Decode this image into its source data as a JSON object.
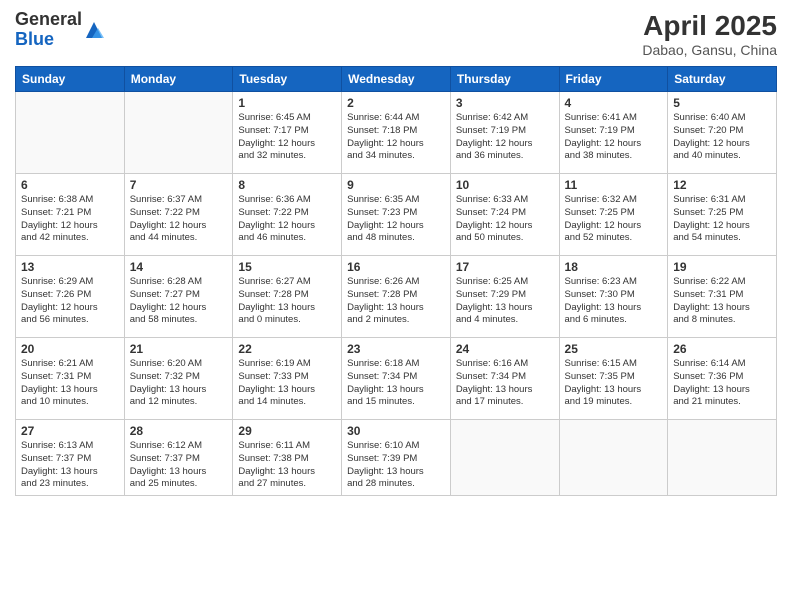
{
  "header": {
    "logo_general": "General",
    "logo_blue": "Blue",
    "month_year": "April 2025",
    "location": "Dabao, Gansu, China"
  },
  "weekdays": [
    "Sunday",
    "Monday",
    "Tuesday",
    "Wednesday",
    "Thursday",
    "Friday",
    "Saturday"
  ],
  "days": [
    {
      "num": "",
      "info": ""
    },
    {
      "num": "",
      "info": ""
    },
    {
      "num": "1",
      "info": "Sunrise: 6:45 AM\nSunset: 7:17 PM\nDaylight: 12 hours\nand 32 minutes."
    },
    {
      "num": "2",
      "info": "Sunrise: 6:44 AM\nSunset: 7:18 PM\nDaylight: 12 hours\nand 34 minutes."
    },
    {
      "num": "3",
      "info": "Sunrise: 6:42 AM\nSunset: 7:19 PM\nDaylight: 12 hours\nand 36 minutes."
    },
    {
      "num": "4",
      "info": "Sunrise: 6:41 AM\nSunset: 7:19 PM\nDaylight: 12 hours\nand 38 minutes."
    },
    {
      "num": "5",
      "info": "Sunrise: 6:40 AM\nSunset: 7:20 PM\nDaylight: 12 hours\nand 40 minutes."
    },
    {
      "num": "6",
      "info": "Sunrise: 6:38 AM\nSunset: 7:21 PM\nDaylight: 12 hours\nand 42 minutes."
    },
    {
      "num": "7",
      "info": "Sunrise: 6:37 AM\nSunset: 7:22 PM\nDaylight: 12 hours\nand 44 minutes."
    },
    {
      "num": "8",
      "info": "Sunrise: 6:36 AM\nSunset: 7:22 PM\nDaylight: 12 hours\nand 46 minutes."
    },
    {
      "num": "9",
      "info": "Sunrise: 6:35 AM\nSunset: 7:23 PM\nDaylight: 12 hours\nand 48 minutes."
    },
    {
      "num": "10",
      "info": "Sunrise: 6:33 AM\nSunset: 7:24 PM\nDaylight: 12 hours\nand 50 minutes."
    },
    {
      "num": "11",
      "info": "Sunrise: 6:32 AM\nSunset: 7:25 PM\nDaylight: 12 hours\nand 52 minutes."
    },
    {
      "num": "12",
      "info": "Sunrise: 6:31 AM\nSunset: 7:25 PM\nDaylight: 12 hours\nand 54 minutes."
    },
    {
      "num": "13",
      "info": "Sunrise: 6:29 AM\nSunset: 7:26 PM\nDaylight: 12 hours\nand 56 minutes."
    },
    {
      "num": "14",
      "info": "Sunrise: 6:28 AM\nSunset: 7:27 PM\nDaylight: 12 hours\nand 58 minutes."
    },
    {
      "num": "15",
      "info": "Sunrise: 6:27 AM\nSunset: 7:28 PM\nDaylight: 13 hours\nand 0 minutes."
    },
    {
      "num": "16",
      "info": "Sunrise: 6:26 AM\nSunset: 7:28 PM\nDaylight: 13 hours\nand 2 minutes."
    },
    {
      "num": "17",
      "info": "Sunrise: 6:25 AM\nSunset: 7:29 PM\nDaylight: 13 hours\nand 4 minutes."
    },
    {
      "num": "18",
      "info": "Sunrise: 6:23 AM\nSunset: 7:30 PM\nDaylight: 13 hours\nand 6 minutes."
    },
    {
      "num": "19",
      "info": "Sunrise: 6:22 AM\nSunset: 7:31 PM\nDaylight: 13 hours\nand 8 minutes."
    },
    {
      "num": "20",
      "info": "Sunrise: 6:21 AM\nSunset: 7:31 PM\nDaylight: 13 hours\nand 10 minutes."
    },
    {
      "num": "21",
      "info": "Sunrise: 6:20 AM\nSunset: 7:32 PM\nDaylight: 13 hours\nand 12 minutes."
    },
    {
      "num": "22",
      "info": "Sunrise: 6:19 AM\nSunset: 7:33 PM\nDaylight: 13 hours\nand 14 minutes."
    },
    {
      "num": "23",
      "info": "Sunrise: 6:18 AM\nSunset: 7:34 PM\nDaylight: 13 hours\nand 15 minutes."
    },
    {
      "num": "24",
      "info": "Sunrise: 6:16 AM\nSunset: 7:34 PM\nDaylight: 13 hours\nand 17 minutes."
    },
    {
      "num": "25",
      "info": "Sunrise: 6:15 AM\nSunset: 7:35 PM\nDaylight: 13 hours\nand 19 minutes."
    },
    {
      "num": "26",
      "info": "Sunrise: 6:14 AM\nSunset: 7:36 PM\nDaylight: 13 hours\nand 21 minutes."
    },
    {
      "num": "27",
      "info": "Sunrise: 6:13 AM\nSunset: 7:37 PM\nDaylight: 13 hours\nand 23 minutes."
    },
    {
      "num": "28",
      "info": "Sunrise: 6:12 AM\nSunset: 7:37 PM\nDaylight: 13 hours\nand 25 minutes."
    },
    {
      "num": "29",
      "info": "Sunrise: 6:11 AM\nSunset: 7:38 PM\nDaylight: 13 hours\nand 27 minutes."
    },
    {
      "num": "30",
      "info": "Sunrise: 6:10 AM\nSunset: 7:39 PM\nDaylight: 13 hours\nand 28 minutes."
    },
    {
      "num": "",
      "info": ""
    },
    {
      "num": "",
      "info": ""
    },
    {
      "num": "",
      "info": ""
    }
  ]
}
